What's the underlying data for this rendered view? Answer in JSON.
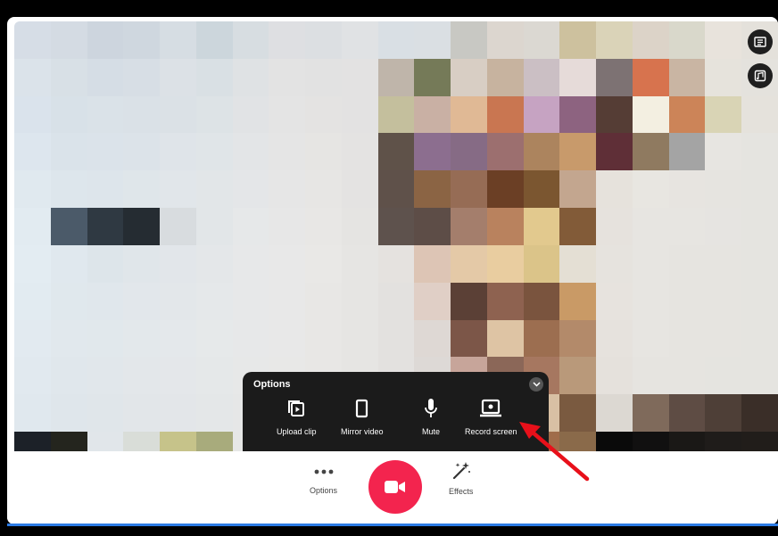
{
  "options_panel": {
    "title": "Options",
    "items": [
      {
        "label": "Upload clip",
        "icon": "upload-clip-icon"
      },
      {
        "label": "Mirror video",
        "icon": "mirror-video-icon"
      },
      {
        "label": "Mute",
        "icon": "microphone-icon"
      },
      {
        "label": "Record screen",
        "icon": "record-screen-icon"
      }
    ]
  },
  "bottom_bar": {
    "options_label": "Options",
    "effects_label": "Effects"
  },
  "colors": {
    "record_button": "#f3244e",
    "panel_bg": "#1b1b1b",
    "annotation_arrow": "#e8101a"
  },
  "video_pixels": [
    [
      "#d6dde6",
      "#d4dbe3",
      "#cdd5de",
      "#cfd7df",
      "#d6dde3",
      "#ccd6dc",
      "#d7dde1",
      "#dedfe2",
      "#dcdfe2",
      "#e0e2e4",
      "#d9dfe4",
      "#dadfe3",
      "#c8c8c3",
      "#dcd6cf",
      "#dbd8d2",
      "#cdc19e",
      "#dad3b8",
      "#dcd3c8",
      "#d9d8cb",
      "#e8e3dc",
      "#e4e1db"
    ],
    [
      "#dbe3ea",
      "#d8e0e6",
      "#d5dde5",
      "#d7dee5",
      "#dce1e6",
      "#d9e0e4",
      "#dfe2e4",
      "#e3e3e3",
      "#e2e2e2",
      "#e3e2e2",
      "#bfb5aa",
      "#757a58",
      "#d8cec4",
      "#c7b39f",
      "#cbbfc4",
      "#e6dbd9",
      "#7d7273",
      "#d7734e",
      "#c9b5a3",
      "#e6e3dc",
      "#e4e2dd"
    ],
    [
      "#dae3ec",
      "#d8e1e8",
      "#dae2e8",
      "#dae1e7",
      "#dbe1e6",
      "#dde3e6",
      "#e1e3e5",
      "#e4e4e4",
      "#e4e3e2",
      "#e3e2e2",
      "#c4bf9d",
      "#c9b0a4",
      "#e0b995",
      "#c97651",
      "#c6a3c2",
      "#8d6380",
      "#553d35",
      "#f3efe1",
      "#cc8458",
      "#d9d4b5",
      "#e5e2dc"
    ],
    [
      "#dde6ee",
      "#dae3ea",
      "#dbe3ea",
      "#dce3e9",
      "#dfe4e9",
      "#e0e5e8",
      "#e3e5e7",
      "#e5e5e5",
      "#e6e5e3",
      "#e4e3e2",
      "#5f5249",
      "#8c6e8f",
      "#866b85",
      "#9c6f6f",
      "#ac845e",
      "#c89a6b",
      "#5f2f37",
      "#8f7a60",
      "#a4a4a4",
      "#e7e5e1",
      "#e5e4e0"
    ],
    [
      "#e0e9ef",
      "#dde6ec",
      "#dde5eb",
      "#dfe6ea",
      "#e1e6ea",
      "#e2e6e8",
      "#e4e6e8",
      "#e6e6e6",
      "#e7e6e4",
      "#e4e3e2",
      "#5f514a",
      "#8b6444",
      "#966c55",
      "#6b3f25",
      "#7b5630",
      "#c3a68f",
      "#e6e2dc",
      "#e8e6e1",
      "#e7e4e0",
      "#e6e4e0",
      "#e5e4e0"
    ],
    [
      "#e2ebf1",
      "#4b5a69",
      "#2f3942",
      "#252c32",
      "#d8dcdf",
      "#e2e6e8",
      "#e6e8e9",
      "#e7e7e7",
      "#e8e7e5",
      "#e5e4e2",
      "#5e524d",
      "#5d4d47",
      "#a47e6c",
      "#b9825e",
      "#e2c98e",
      "#825b38",
      "#e6e2dd",
      "#e7e5e1",
      "#e7e5e1",
      "#e6e4e1",
      "#e5e4e0"
    ],
    [
      "#e3ecf2",
      "#e0e8ee",
      "#dde5ea",
      "#e0e6ea",
      "#e2e6ea",
      "#e4e7e9",
      "#e7e8e9",
      "#e8e8e8",
      "#e9e8e6",
      "#e6e5e3",
      "#e5e2df",
      "#ddc5b5",
      "#e4c9a7",
      "#e9cda0",
      "#dbc489",
      "#e4dfd4",
      "#e6e3de",
      "#e7e5e1",
      "#e6e4e0",
      "#e6e4e0",
      "#e5e4e0"
    ],
    [
      "#e2ebf1",
      "#e0e8ed",
      "#e0e7ec",
      "#e2e7eb",
      "#e3e7ea",
      "#e5e8ea",
      "#e7e8e9",
      "#e8e8e8",
      "#e8e7e5",
      "#e6e5e3",
      "#e3e1df",
      "#e0cfc6",
      "#5b4036",
      "#8e6250",
      "#7a543e",
      "#c99a66",
      "#e7e3de",
      "#e7e5e1",
      "#e6e4e0",
      "#e6e4e0",
      "#e5e4e0"
    ],
    [
      "#e2eaf0",
      "#e1e8ed",
      "#e1e8ec",
      "#e3e8eb",
      "#e4e8eb",
      "#e6e9ea",
      "#e7e8e9",
      "#e8e8e8",
      "#e8e7e5",
      "#e6e5e3",
      "#e3e1df",
      "#ded8d4",
      "#7c5648",
      "#dec4a4",
      "#9c6e50",
      "#b38a6a",
      "#e6e2dd",
      "#e7e5e1",
      "#e6e4e0",
      "#e6e4e0",
      "#e5e4e0"
    ],
    [
      "#e1e9ef",
      "#e0e7ec",
      "#e1e7eb",
      "#e3e7ea",
      "#e4e7ea",
      "#e5e8e9",
      "#e7e8e8",
      "#e8e8e7",
      "#e8e7e5",
      "#e6e5e3",
      "#e3e1df",
      "#ddd9d6",
      "#c7a59a",
      "#8b6758",
      "#a67760",
      "#b9997a",
      "#e5e1dc",
      "#e6e4e0",
      "#e6e4e0",
      "#e5e4e0",
      "#e5e4e0"
    ],
    [
      "#e0e8ee",
      "#dfe6eb",
      "#e0e6ea",
      "#e2e6e9",
      "#e3e6e9",
      "#e4e7e8",
      "#e6e7e7",
      "#e7e7e6",
      "#e7e6e4",
      "#e5e4e2",
      "#e2e0de",
      "#dcd7d3",
      "#9b6d5c",
      "#b17d5f",
      "#d8c0a4",
      "#7a5a40",
      "#dcd8d2",
      "#7f6a5b",
      "#5e4c44",
      "#4e3f37",
      "#3a2e28"
    ],
    [
      "#1c2128",
      "#24251e",
      "#e1e6ea",
      "#d9ddd8",
      "#c6c38a",
      "#a8ab7c",
      "#e6e7e6",
      "#e6e6e5",
      "#e6e5e3",
      "#e4e3e1",
      "#1a1616",
      "#1c1818",
      "#5a3a2a",
      "#8a5a3c",
      "#a06c4a",
      "#8a6a4a",
      "#0a0a0a",
      "#111010",
      "#1a1816",
      "#1f1c1a",
      "#211d1a"
    ]
  ]
}
